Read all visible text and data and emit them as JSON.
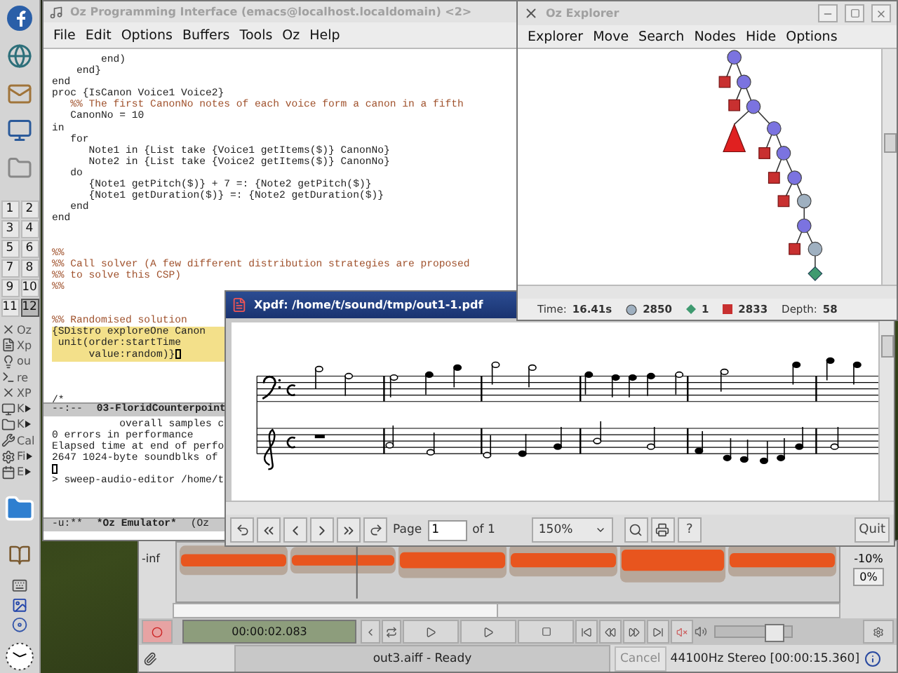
{
  "panel": {
    "pager": [
      {
        "label": "1",
        "selected": false
      },
      {
        "label": "2",
        "selected": false
      },
      {
        "label": "3",
        "selected": false
      },
      {
        "label": "4",
        "selected": false
      },
      {
        "label": "5",
        "selected": false
      },
      {
        "label": "6",
        "selected": false
      },
      {
        "label": "7",
        "selected": false
      },
      {
        "label": "8",
        "selected": false
      },
      {
        "label": "9",
        "selected": false
      },
      {
        "label": "10",
        "selected": false
      },
      {
        "label": "11",
        "selected": false
      },
      {
        "label": "12",
        "selected": true
      }
    ],
    "tasks": [
      {
        "label": "Oz",
        "submenu": false
      },
      {
        "label": "Xp",
        "submenu": false
      },
      {
        "label": "ou",
        "submenu": false
      },
      {
        "label": "re",
        "submenu": false
      },
      {
        "label": "XP",
        "submenu": false
      },
      {
        "label": "K",
        "submenu": true
      },
      {
        "label": "K",
        "submenu": true
      },
      {
        "label": "Cal",
        "submenu": false
      },
      {
        "label": "Fi",
        "submenu": true
      },
      {
        "label": "E",
        "submenu": true
      }
    ]
  },
  "emacs": {
    "title": "Oz Programming Interface (emacs@localhost.localdomain) <2>",
    "active": false,
    "menu": [
      "File",
      "Edit",
      "Options",
      "Buffers",
      "Tools",
      "Oz",
      "Help"
    ],
    "code": [
      {
        "text": "        end)",
        "kind": "code",
        "cursor": false
      },
      {
        "text": "    end}",
        "kind": "code",
        "cursor": false
      },
      {
        "text": "end",
        "kind": "code",
        "cursor": false
      },
      {
        "text": "proc {IsCanon Voice1 Voice2}",
        "kind": "code",
        "cursor": false
      },
      {
        "text": "   %% The first CanonNo notes of each voice form a canon in a fifth",
        "kind": "comment",
        "cursor": false
      },
      {
        "text": "   CanonNo = 10",
        "kind": "code",
        "cursor": false
      },
      {
        "text": "in",
        "kind": "code",
        "cursor": false
      },
      {
        "text": "   for",
        "kind": "code",
        "cursor": false
      },
      {
        "text": "      Note1 in {List take {Voice1 getItems($)} CanonNo}",
        "kind": "code",
        "cursor": false
      },
      {
        "text": "      Note2 in {List take {Voice2 getItems($)} CanonNo}",
        "kind": "code",
        "cursor": false
      },
      {
        "text": "   do",
        "kind": "code",
        "cursor": false
      },
      {
        "text": "      {Note1 getPitch($)} + 7 =: {Note2 getPitch($)}",
        "kind": "code",
        "cursor": false
      },
      {
        "text": "      {Note1 getDuration($)} =: {Note2 getDuration($)}",
        "kind": "code",
        "cursor": false
      },
      {
        "text": "   end",
        "kind": "code",
        "cursor": false
      },
      {
        "text": "end",
        "kind": "code",
        "cursor": false
      },
      {
        "kind": "blank",
        "cursor": false
      },
      {
        "kind": "blank",
        "cursor": false
      },
      {
        "text": "%%",
        "kind": "comment",
        "cursor": false
      },
      {
        "text": "%% Call solver (A few different distribution strategies are proposed",
        "kind": "comment",
        "cursor": false
      },
      {
        "text": "%% to solve this CSP)",
        "kind": "comment",
        "cursor": false
      },
      {
        "text": "%%",
        "kind": "comment",
        "cursor": false
      },
      {
        "kind": "blank",
        "cursor": false
      },
      {
        "kind": "blank",
        "cursor": false
      },
      {
        "text": "%% Randomised solution",
        "kind": "comment",
        "cursor": false
      },
      {
        "text": "{SDistro exploreOne Canon",
        "kind": "region",
        "cursor": false
      },
      {
        "text": " unit(order:startTime",
        "kind": "region",
        "cursor": false
      },
      {
        "text": "      value:random)}",
        "kind": "region",
        "cursor": true
      },
      {
        "kind": "blank",
        "cursor": false
      },
      {
        "kind": "blank",
        "cursor": false
      },
      {
        "kind": "blank",
        "cursor": false
      },
      {
        "text": "/*",
        "kind": "code",
        "cursor": false
      }
    ],
    "modeline_top": {
      "status": "--:--",
      "buffer": "03-FloridCounterpoint"
    },
    "output": [
      {
        "text": "           overall samples c",
        "kind": "text"
      },
      {
        "text": "0 errors in performance",
        "kind": "text"
      },
      {
        "text": "Elapsed time at end of perfo",
        "kind": "text"
      },
      {
        "text": "2647 1024-byte soundblks of",
        "kind": "text"
      },
      {
        "kind": "cursor"
      },
      {
        "text": "> sweep-audio-editor /home/t",
        "kind": "text"
      }
    ],
    "modeline_bottom": {
      "status": "-u:**",
      "buffer": "*Oz Emulator*",
      "mode": "(Oz"
    }
  },
  "explorer": {
    "title": "Oz Explorer",
    "active": false,
    "menu": [
      "Explorer",
      "Move",
      "Search",
      "Nodes",
      "Hide",
      "Options"
    ],
    "status": {
      "time_label": "Time:",
      "time": "16.41s",
      "choice": "2850",
      "solved": "1",
      "failed": "2833",
      "depth_label": "Depth:",
      "depth": "58"
    }
  },
  "xpdf": {
    "title": "Xpdf: /home/t/sound/tmp/out1-1.pdf",
    "active": true,
    "page_label": "Page",
    "page": "1",
    "page_count": "of 1",
    "zoom": "150%",
    "help": "?",
    "quit": "Quit"
  },
  "sweep": {
    "level_label": "-inf",
    "scale_label": "-10%",
    "zoom_button": "0%",
    "time": "00:00:02.083",
    "volume": {
      "level": 0.75
    },
    "status": "out3.aiff - Ready",
    "cancel": {
      "label": "Cancel",
      "disabled": true
    },
    "info": "44100Hz Stereo [00:00:15.360]"
  }
}
